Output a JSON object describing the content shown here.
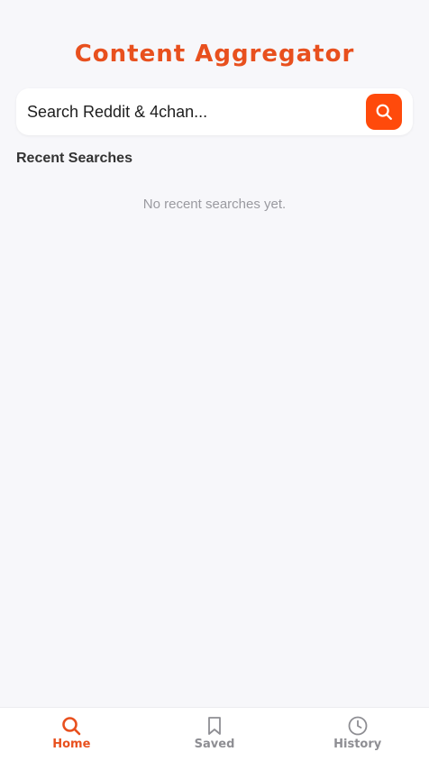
{
  "app": {
    "title": "Content Aggregator"
  },
  "search": {
    "placeholder": "Search Reddit & 4chan...",
    "value": "",
    "button_icon": "search-icon"
  },
  "recent": {
    "heading": "Recent Searches",
    "empty_message": "No recent searches yet."
  },
  "tabs": [
    {
      "label": "Home",
      "icon": "search-icon",
      "active": true
    },
    {
      "label": "Saved",
      "icon": "bookmark-icon",
      "active": false
    },
    {
      "label": "History",
      "icon": "clock-icon",
      "active": false
    }
  ],
  "colors": {
    "accent": "#e8501e",
    "button": "#ff4a0b",
    "inactive": "#8e8e93",
    "background": "#f7f7fa"
  }
}
